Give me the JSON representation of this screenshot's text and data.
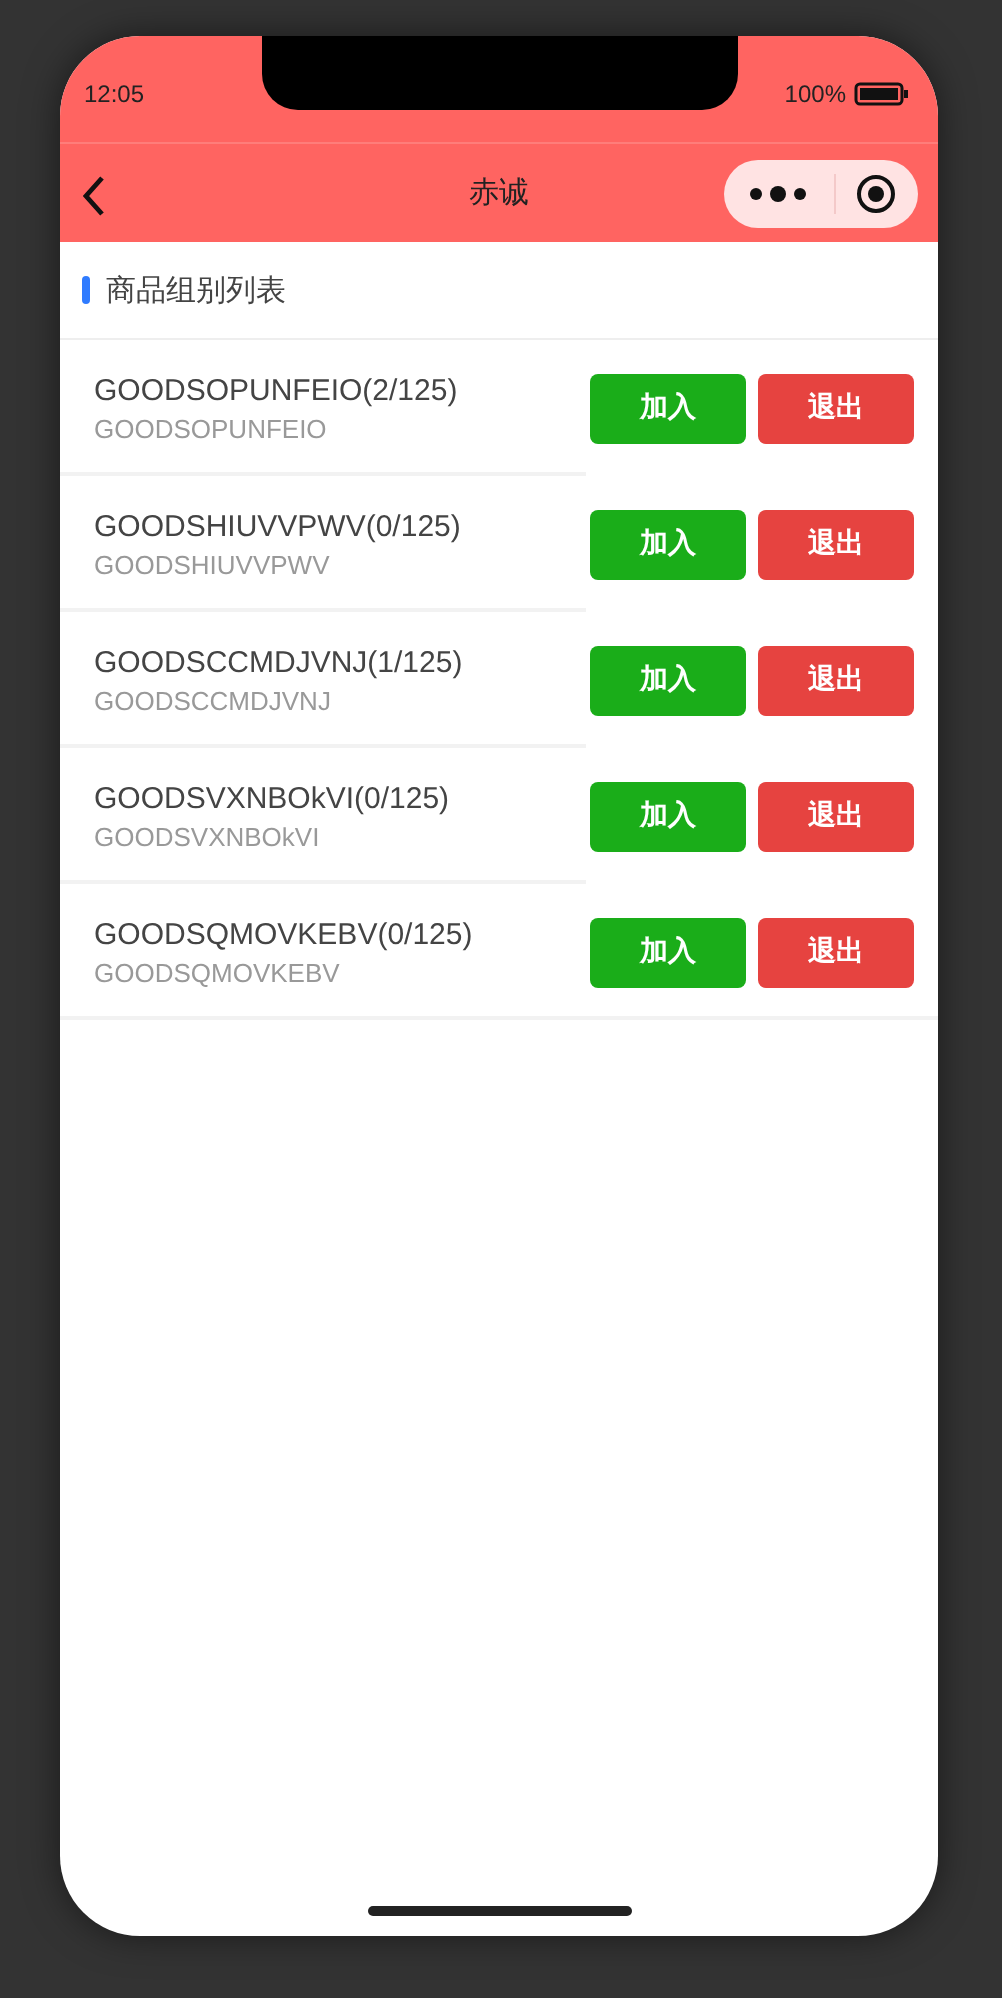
{
  "status_bar": {
    "time": "12:05",
    "battery": "100%"
  },
  "nav": {
    "title": "赤诚"
  },
  "section": {
    "title": "商品组别列表"
  },
  "groups": [
    {
      "name": "GOODSOPUNFEIO(2/125)",
      "code": "GOODSOPUNFEIO",
      "join": "加入",
      "leave": "退出"
    },
    {
      "name": "GOODSHIUVVPWV(0/125)",
      "code": "GOODSHIUVVPWV",
      "join": "加入",
      "leave": "退出"
    },
    {
      "name": "GOODSCCMDJVNJ(1/125)",
      "code": "GOODSCCMDJVNJ",
      "join": "加入",
      "leave": "退出"
    },
    {
      "name": "GOODSVXNBOkVI(0/125)",
      "code": "GOODSVXNBOkVI",
      "join": "加入",
      "leave": "退出"
    },
    {
      "name": "GOODSQMOVKEBV(0/125)",
      "code": "GOODSQMOVKEBV",
      "join": "加入",
      "leave": "退出"
    }
  ]
}
